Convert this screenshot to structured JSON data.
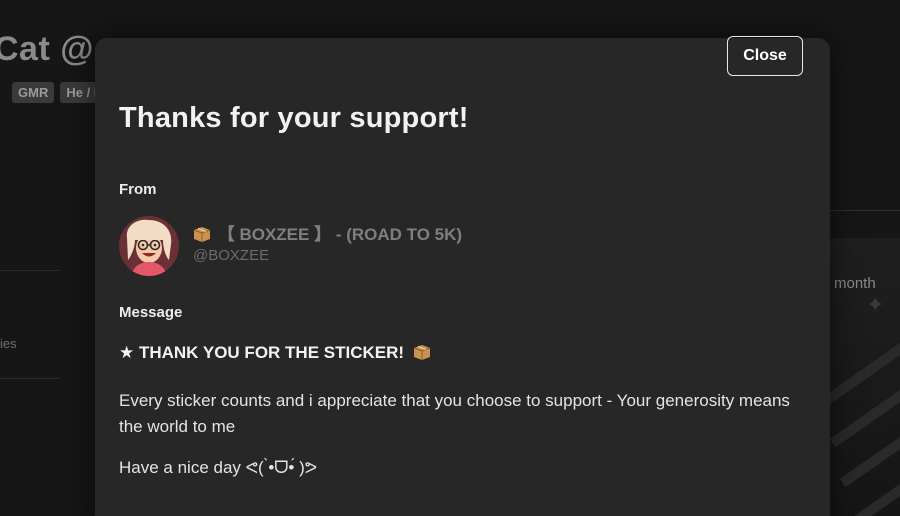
{
  "background": {
    "profile_title": "Cat @",
    "badges": [
      "GMR",
      "He / I"
    ],
    "left_item_text": "ies",
    "right_card_text": "month"
  },
  "modal": {
    "close_label": "Close",
    "title": "Thanks for your support!",
    "from_label": "From",
    "sender": {
      "avatar_icon": "avatar-cartoon-girl",
      "name": "【 BOXZEE 】 - (ROAD TO 5K)",
      "name_icon": "package-icon",
      "handle": "@BOXZEE"
    },
    "message_label": "Message",
    "message": {
      "headline": "★ THANK YOU FOR THE STICKER!",
      "headline_icon": "package-icon",
      "body": "Every sticker counts and i appreciate that you choose to support - Your generosity means the world to me",
      "sign_off": "Have a nice day ᕙ( ̀•ᗜ•́ )ᕗ"
    }
  },
  "colors": {
    "page_background": "#161616",
    "modal_background": "#272727",
    "text_primary": "#f2f2f2",
    "text_muted": "#7f7f7f"
  }
}
